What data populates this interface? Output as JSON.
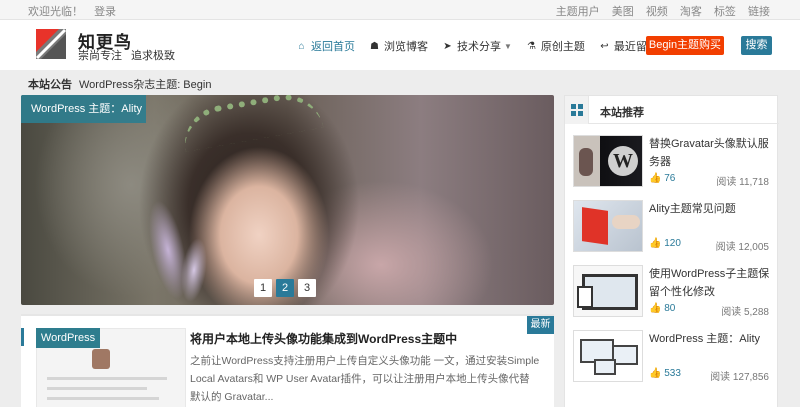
{
  "topbar": {
    "welcome": "欢迎光临！",
    "login": "登录",
    "links": [
      "主题用户",
      "美图",
      "视频",
      "淘客",
      "标签",
      "链接"
    ]
  },
  "header": {
    "site_name": "知更鸟",
    "slogan": "崇尚专注  追求极致",
    "nav": [
      {
        "label": "返回首页",
        "icon": "home-icon",
        "active": true
      },
      {
        "label": "浏览博客",
        "icon": "sitemap-icon"
      },
      {
        "label": "技术分享",
        "icon": "paper-plane-icon",
        "dropdown": true
      },
      {
        "label": "原创主题",
        "icon": "flask-icon"
      },
      {
        "label": "最近留言",
        "icon": "reply-icon"
      }
    ],
    "cta_label": "Begin主题购买",
    "search_label": "搜索"
  },
  "notice": {
    "label": "本站公告",
    "text": "WordPress杂志主题: Begin"
  },
  "slider": {
    "tag": "WordPress 主题：Ality",
    "pages": [
      "1",
      "2",
      "3"
    ],
    "current_page": "2"
  },
  "post": {
    "category": "WordPress",
    "badge": "最新",
    "title": "将用户本地上传头像功能集成到WordPress主题中",
    "excerpt": "之前让WordPress支持注册用户上传自定义头像功能 一文，通过安装Simple Local Avatars和 WP User Avatar插件，可以让注册用户本地上传头像代替默认的 Gravatar..."
  },
  "sidebar": {
    "title": "本站推荐",
    "items": [
      {
        "title": "替换Gravatar头像默认服务器",
        "likes": "76",
        "reads": "阅读 11,718"
      },
      {
        "title": "Ality主题常见问题",
        "likes": "120",
        "reads": "阅读 12,005"
      },
      {
        "title": "使用WordPress子主题保留个性化修改",
        "likes": "80",
        "reads": "阅读 5,288"
      },
      {
        "title": "WordPress 主题：Ality",
        "likes": "533",
        "reads": "阅读 127,856"
      }
    ]
  },
  "colors": {
    "accent": "#2a7a99",
    "cta": "#f23e00",
    "tag_bg": "#2e7d8e"
  }
}
